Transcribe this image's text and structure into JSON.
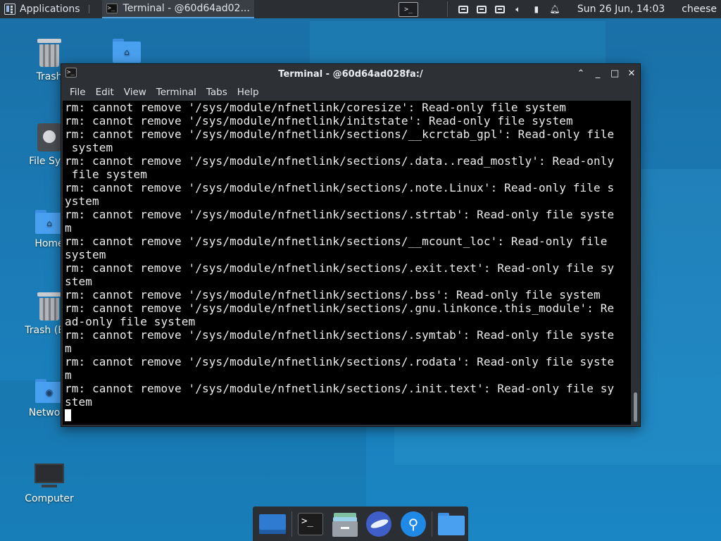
{
  "top_panel": {
    "applications_label": "Applications",
    "task_title": "Terminal - @60d64ad02...",
    "clock": "Sun 26 Jun, 14:03",
    "user": "cheese",
    "tray_icons": [
      "display-icon",
      "display-icon",
      "display-icon",
      "volume-icon",
      "battery-icon",
      "notification-bell-icon"
    ]
  },
  "desktop_icons": [
    {
      "label": "Trash",
      "icon": "trash-icon"
    },
    {
      "label": "File Syst",
      "icon": "drive-icon"
    },
    {
      "label": "Home",
      "icon": "home-folder-icon"
    },
    {
      "label": "Trash (Em",
      "icon": "trash-icon"
    },
    {
      "label": "Network",
      "icon": "network-folder-icon"
    },
    {
      "label": "Computer",
      "icon": "computer-icon"
    }
  ],
  "terminal": {
    "title": "Terminal - @60d64ad028fa:/",
    "menu": [
      "File",
      "Edit",
      "View",
      "Terminal",
      "Tabs",
      "Help"
    ],
    "lines": [
      "rm: cannot remove '/sys/module/nfnetlink/coresize': Read-only file system",
      "rm: cannot remove '/sys/module/nfnetlink/initstate': Read-only file system",
      "rm: cannot remove '/sys/module/nfnetlink/sections/__kcrctab_gpl': Read-only file",
      " system",
      "rm: cannot remove '/sys/module/nfnetlink/sections/.data..read_mostly': Read-only",
      " file system",
      "rm: cannot remove '/sys/module/nfnetlink/sections/.note.Linux': Read-only file s",
      "ystem",
      "rm: cannot remove '/sys/module/nfnetlink/sections/.strtab': Read-only file syste",
      "m",
      "rm: cannot remove '/sys/module/nfnetlink/sections/__mcount_loc': Read-only file",
      "system",
      "rm: cannot remove '/sys/module/nfnetlink/sections/.exit.text': Read-only file sy",
      "stem",
      "rm: cannot remove '/sys/module/nfnetlink/sections/.bss': Read-only file system",
      "rm: cannot remove '/sys/module/nfnetlink/sections/.gnu.linkonce.this_module': Re",
      "ad-only file system",
      "rm: cannot remove '/sys/module/nfnetlink/sections/.symtab': Read-only file syste",
      "m",
      "rm: cannot remove '/sys/module/nfnetlink/sections/.rodata': Read-only file syste",
      "m",
      "rm: cannot remove '/sys/module/nfnetlink/sections/.init.text': Read-only file sy",
      "stem"
    ]
  },
  "dock": {
    "items": [
      "show-desktop-icon",
      "terminal-icon",
      "file-manager-icon",
      "web-browser-icon",
      "app-finder-icon",
      "folder-icon"
    ]
  }
}
